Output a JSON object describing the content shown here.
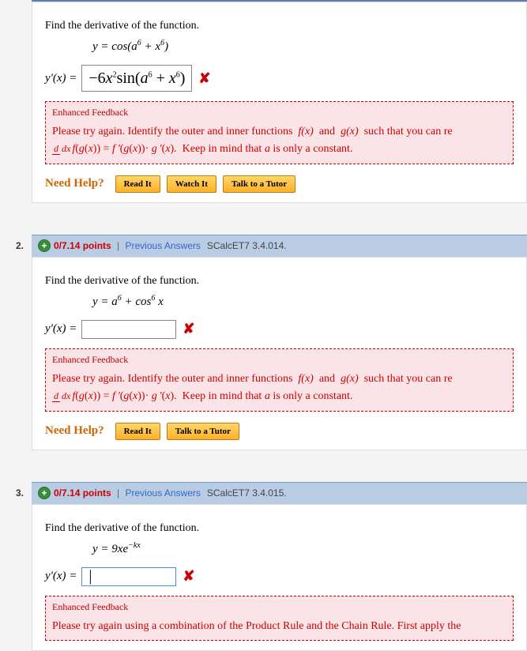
{
  "q1": {
    "prompt": "Find the derivative of the function.",
    "equation_html": "y = cos(a<sup>6</sup> + x<sup>6</sup>)",
    "answer_label": "y'(x) =",
    "student_answer_html": "−6<i>x</i><sup>2</sup>sin(<i>a</i><sup>6</sup> + <i>x</i><sup>6</sup>)",
    "feedback_title": "Enhanced Feedback",
    "feedback_body_html": "Please try again. Identify the outer and inner functions  <span class=\"fx\">f(x)</span>  and  <span class=\"fx\">g(x)</span>  such that you can re",
    "feedback_line2_html": "<span class=\"frac\"><span class=\"top\">d</span><span class=\"bot\">dx</span></span><span class=\"fx\">f</span>(<span class=\"fx\">g</span>(<span class=\"fx\">x</span>)) = <span class=\"fx\">f<span class=\"caret\"> '</span></span>(<span class=\"fx\">g</span>(<span class=\"fx\">x</span>))· <span class=\"fx\">g<span class=\"caret\"> '</span></span>(<span class=\"fx\">x</span>).  Keep in mind that <span class=\"fx\">a</span> is only a constant.",
    "needhelp_label": "Need Help?",
    "buttons": {
      "read": "Read It",
      "watch": "Watch It",
      "tutor": "Talk to a Tutor"
    }
  },
  "q2": {
    "number": "2.",
    "points": "0/7.14 points",
    "prev": "Previous Answers",
    "ref": "SCalcET7 3.4.014.",
    "prompt": "Find the derivative of the function.",
    "equation_html": "y = a<sup>6</sup> + cos<sup>6</sup> x",
    "answer_label": "y'(x) =",
    "feedback_title": "Enhanced Feedback",
    "feedback_body_html": "Please try again. Identify the outer and inner functions  <span class=\"fx\">f(x)</span>  and  <span class=\"fx\">g(x)</span>  such that you can re",
    "feedback_line2_html": "<span class=\"frac\"><span class=\"top\">d</span><span class=\"bot\">dx</span></span><span class=\"fx\">f</span>(<span class=\"fx\">g</span>(<span class=\"fx\">x</span>)) = <span class=\"fx\">f<span class=\"caret\"> '</span></span>(<span class=\"fx\">g</span>(<span class=\"fx\">x</span>))· <span class=\"fx\">g<span class=\"caret\"> '</span></span>(<span class=\"fx\">x</span>).  Keep in mind that <span class=\"fx\">a</span> is only a constant.",
    "needhelp_label": "Need Help?",
    "buttons": {
      "read": "Read It",
      "tutor": "Talk to a Tutor"
    }
  },
  "q3": {
    "number": "3.",
    "points": "0/7.14 points",
    "prev": "Previous Answers",
    "ref": "SCalcET7 3.4.015.",
    "prompt": "Find the derivative of the function.",
    "equation_html": "y = 9xe<sup>−kx</sup>",
    "answer_label": "y'(x) =",
    "feedback_title": "Enhanced Feedback",
    "feedback_body_html": "Please try again using a combination of the Product Rule and the Chain Rule. First apply the"
  }
}
